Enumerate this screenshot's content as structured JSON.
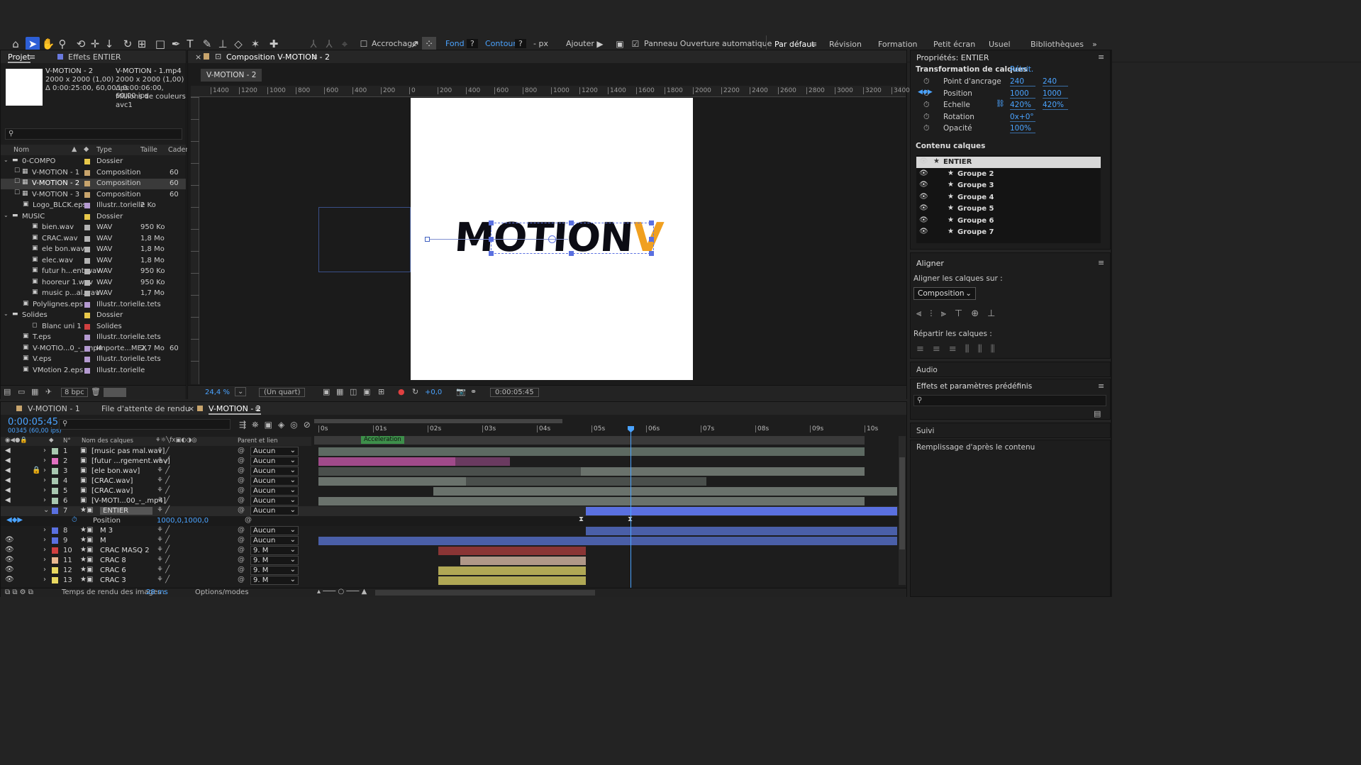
{
  "toolbar": {
    "snap": "Accrochage",
    "fill": "Fond :",
    "fill_val": "?",
    "stroke": "Contour :",
    "stroke_val": "?",
    "px": "- px",
    "add": "Ajouter :",
    "auto_open": "Panneau Ouverture automatique",
    "workspaces": [
      "Par défaut",
      "Révision",
      "Formation",
      "Petit écran",
      "Usuel",
      "Bibliothèques"
    ]
  },
  "project": {
    "tab1": "Projet",
    "tab2": "Effets ENTIER",
    "sel_name": "V-MOTION - 2",
    "sel_info1": "2000 x 2000 (1,00)",
    "sel_info2": "Δ 0:00:25:00, 60,00 ips",
    "info_name": "V-MOTION - 1.mp4",
    "info1": "2000 x 2000 (1,00)",
    "info2": "Δ 0:00:06:00, 60,00 ips",
    "info3": "Millions de couleurs",
    "info4": "avc1",
    "cols": [
      "Nom",
      "Type",
      "Taille",
      "Cadence"
    ],
    "items": [
      {
        "name": "0-COMPO",
        "type": "Dossier",
        "size": "",
        "fps": "",
        "color": "#e8c84a",
        "indent": 0
      },
      {
        "name": "V-MOTION - 1",
        "type": "Composition",
        "size": "",
        "fps": "60",
        "color": "#c8a46c",
        "indent": 1
      },
      {
        "name": "V-MOTION - 2",
        "type": "Composition",
        "size": "",
        "fps": "60",
        "color": "#c8a46c",
        "indent": 1
      },
      {
        "name": "V-MOTION - 3",
        "type": "Composition",
        "size": "",
        "fps": "60",
        "color": "#c8a46c",
        "indent": 1
      },
      {
        "name": "Logo_BLCK.eps",
        "type": "Illustr..torielle",
        "size": "2 Ko",
        "fps": "",
        "color": "#b49ad0",
        "indent": 1
      },
      {
        "name": "MUSIC",
        "type": "Dossier",
        "size": "",
        "fps": "",
        "color": "#e8c84a",
        "indent": 0
      },
      {
        "name": "bien.wav",
        "type": "WAV",
        "size": "950 Ko",
        "fps": "",
        "color": "#b4b4b4",
        "indent": 2
      },
      {
        "name": "CRAC.wav",
        "type": "WAV",
        "size": "1,8 Mo",
        "fps": "",
        "color": "#b4b4b4",
        "indent": 2
      },
      {
        "name": "ele bon.wav",
        "type": "WAV",
        "size": "1,8 Mo",
        "fps": "",
        "color": "#b4b4b4",
        "indent": 2
      },
      {
        "name": "elec.wav",
        "type": "WAV",
        "size": "1,8 Mo",
        "fps": "",
        "color": "#b4b4b4",
        "indent": 2
      },
      {
        "name": "futur h...ent.wav",
        "type": "WAV",
        "size": "950 Ko",
        "fps": "",
        "color": "#b4b4b4",
        "indent": 2
      },
      {
        "name": "hooreur 1.wav",
        "type": "WAV",
        "size": "950 Ko",
        "fps": "",
        "color": "#b4b4b4",
        "indent": 2
      },
      {
        "name": "music p...al.wav",
        "type": "WAV",
        "size": "1,7 Mo",
        "fps": "",
        "color": "#b4b4b4",
        "indent": 2
      },
      {
        "name": "Polylignes.eps",
        "type": "Illustr..torielle",
        "size": "...tets",
        "fps": "",
        "color": "#b49ad0",
        "indent": 1
      },
      {
        "name": "Solides",
        "type": "Dossier",
        "size": "",
        "fps": "",
        "color": "#e8c84a",
        "indent": 0
      },
      {
        "name": "Blanc uni 1",
        "type": "Solides",
        "size": "",
        "fps": "",
        "color": "#d04040",
        "indent": 2
      },
      {
        "name": "T.eps",
        "type": "Illustr..torielle",
        "size": "...tets",
        "fps": "",
        "color": "#b49ad0",
        "indent": 1
      },
      {
        "name": "V-MOTIO...0_-_.mp4",
        "type": "Importe...MEX",
        "size": "2,7 Mo",
        "fps": "60",
        "color": "#b49ad0",
        "indent": 1
      },
      {
        "name": "V.eps",
        "type": "Illustr..torielle",
        "size": "...tets",
        "fps": "",
        "color": "#b49ad0",
        "indent": 1
      },
      {
        "name": "VMotion 2.eps",
        "type": "Illustr..torielle",
        "size": "",
        "fps": "",
        "color": "#b49ad0",
        "indent": 1
      }
    ],
    "bpc": "8 bpc"
  },
  "comp": {
    "tab": "Composition V-MOTION - 2",
    "subtab": "V-MOTION - 2",
    "zoom": "24,4 %",
    "quality": "(Un quart)",
    "exposure": "+0,0",
    "timecode": "0:00:05:45",
    "ruler_labels": [
      "1400",
      "1200",
      "1000",
      "800",
      "600",
      "400",
      "200",
      "0",
      "200",
      "400",
      "600",
      "800",
      "1000",
      "1200",
      "1400",
      "1600",
      "1800",
      "2000",
      "2200",
      "2400",
      "2600",
      "2800",
      "3000",
      "3200",
      "3400"
    ],
    "logo_text": "MOTION",
    "logo_v": "V"
  },
  "timeline": {
    "tabs": [
      "V-MOTION - 1",
      "File d'attente de rendu",
      "V-MOTION - 2"
    ],
    "time": "0:00:05:45",
    "frames": "00345 (60,00 ips)",
    "col_num": "N°",
    "col_name": "Nom des calques",
    "col_parent": "Parent et lien",
    "ticks": [
      "0s",
      "01s",
      "02s",
      "03s",
      "04s",
      "05s",
      "06s",
      "07s",
      "08s",
      "09s",
      "10s"
    ],
    "marker": "Acceleration",
    "layers": [
      {
        "n": "1",
        "name": "[music pas mal.wav]",
        "parent": "Aucun",
        "color": "#a8c8b0"
      },
      {
        "n": "2",
        "name": "[futur ...rgement.wav]",
        "parent": "Aucun",
        "color": "#e070c0"
      },
      {
        "n": "3",
        "name": "[ele bon.wav]",
        "parent": "Aucun",
        "color": "#a8c8b0"
      },
      {
        "n": "4",
        "name": "[CRAC.wav]",
        "parent": "Aucun",
        "color": "#a8c8b0"
      },
      {
        "n": "5",
        "name": "[CRAC.wav]",
        "parent": "Aucun",
        "color": "#a8c8b0"
      },
      {
        "n": "6",
        "name": "[V-MOTI...00_-_.mp4]",
        "parent": "Aucun",
        "color": "#a8c8b0"
      },
      {
        "n": "7",
        "name": "ENTIER",
        "parent": "Aucun",
        "color": "#5a70e0"
      },
      {
        "n": "8",
        "name": "M 3",
        "parent": "Aucun",
        "color": "#5a70e0"
      },
      {
        "n": "9",
        "name": "M",
        "parent": "Aucun",
        "color": "#5a70e0"
      },
      {
        "n": "10",
        "name": "CRAC MASQ 2",
        "parent": "9. M",
        "color": "#d04040"
      },
      {
        "n": "11",
        "name": "CRAC 8",
        "parent": "9. M",
        "color": "#e8b890"
      },
      {
        "n": "12",
        "name": "CRAC 6",
        "parent": "9. M",
        "color": "#e8d860"
      },
      {
        "n": "13",
        "name": "CRAC 3",
        "parent": "9. M",
        "color": "#e8d860"
      }
    ],
    "position_label": "Position",
    "position_val": "1000,0,1000,0",
    "render_time_label": "Temps de rendu des images :",
    "render_time": "28 ms",
    "options": "Options/modes"
  },
  "props": {
    "title": "Propriétés: ENTIER",
    "transform": "Transformation de calques",
    "reset": "Réinit.",
    "rows": [
      {
        "label": "Point d'ancrage",
        "v1": "240",
        "v2": "240"
      },
      {
        "label": "Position",
        "v1": "1000",
        "v2": "1000"
      },
      {
        "label": "Echelle",
        "v1": "420%",
        "v2": "420%"
      },
      {
        "label": "Rotation",
        "v1": "0x+0°",
        "v2": ""
      },
      {
        "label": "Opacité",
        "v1": "100%",
        "v2": ""
      }
    ],
    "content": "Contenu calques",
    "groups": [
      "ENTIER",
      "Groupe 2",
      "Groupe 3",
      "Groupe 4",
      "Groupe 5",
      "Groupe 6",
      "Groupe 7"
    ]
  },
  "align": {
    "title": "Aligner",
    "label": "Aligner les calques sur :",
    "target": "Composition",
    "distribute": "Répartir les calques :"
  },
  "right": {
    "audio": "Audio",
    "effects": "Effets et paramètres prédéfinis",
    "suivi": "Suivi",
    "fill": "Remplissage d'après le contenu"
  }
}
